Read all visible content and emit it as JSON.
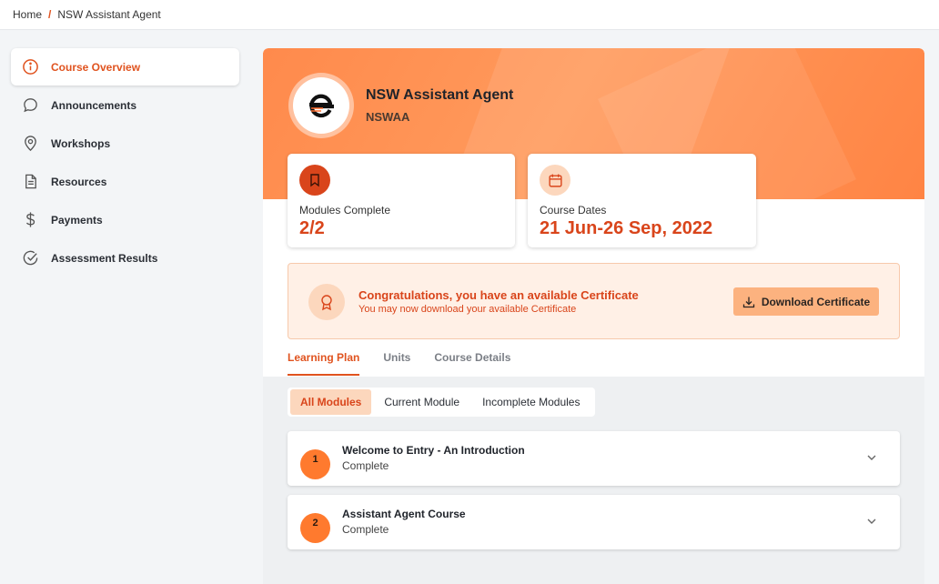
{
  "breadcrumb": {
    "home": "Home",
    "separator": "/",
    "current": "NSW Assistant Agent"
  },
  "sidebar": {
    "items": [
      {
        "label": "Course Overview",
        "icon": "info-circle-icon",
        "active": true
      },
      {
        "label": "Announcements",
        "icon": "chat-bubble-icon",
        "active": false
      },
      {
        "label": "Workshops",
        "icon": "location-pin-icon",
        "active": false
      },
      {
        "label": "Resources",
        "icon": "document-icon",
        "active": false
      },
      {
        "label": "Payments",
        "icon": "dollar-icon",
        "active": false
      },
      {
        "label": "Assessment Results",
        "icon": "check-circle-icon",
        "active": false
      }
    ]
  },
  "course": {
    "title": "NSW Assistant Agent",
    "code": "NSWAA"
  },
  "stats": {
    "modules": {
      "label": "Modules Complete",
      "value": "2/2",
      "icon": "bookmark-icon"
    },
    "dates": {
      "label": "Course Dates",
      "value": "21 Jun-26 Sep, 2022",
      "icon": "calendar-icon"
    }
  },
  "certificate": {
    "title": "Congratulations, you have an available Certificate",
    "subtitle": "You may now download your available Certificate",
    "button": "Download Certificate",
    "icon": "award-ribbon-icon"
  },
  "tabs": [
    {
      "label": "Learning Plan",
      "active": true
    },
    {
      "label": "Units",
      "active": false
    },
    {
      "label": "Course Details",
      "active": false
    }
  ],
  "filters": [
    {
      "label": "All Modules",
      "active": true
    },
    {
      "label": "Current Module",
      "active": false
    },
    {
      "label": "Incomplete Modules",
      "active": false
    }
  ],
  "modules": [
    {
      "number": "1",
      "title": "Welcome to Entry - An Introduction",
      "status": "Complete"
    },
    {
      "number": "2",
      "title": "Assistant Agent Course",
      "status": "Complete"
    }
  ],
  "colors": {
    "accent": "#e0531f",
    "banner": "#ff8a4c",
    "highlight": "#fcd7bd"
  }
}
